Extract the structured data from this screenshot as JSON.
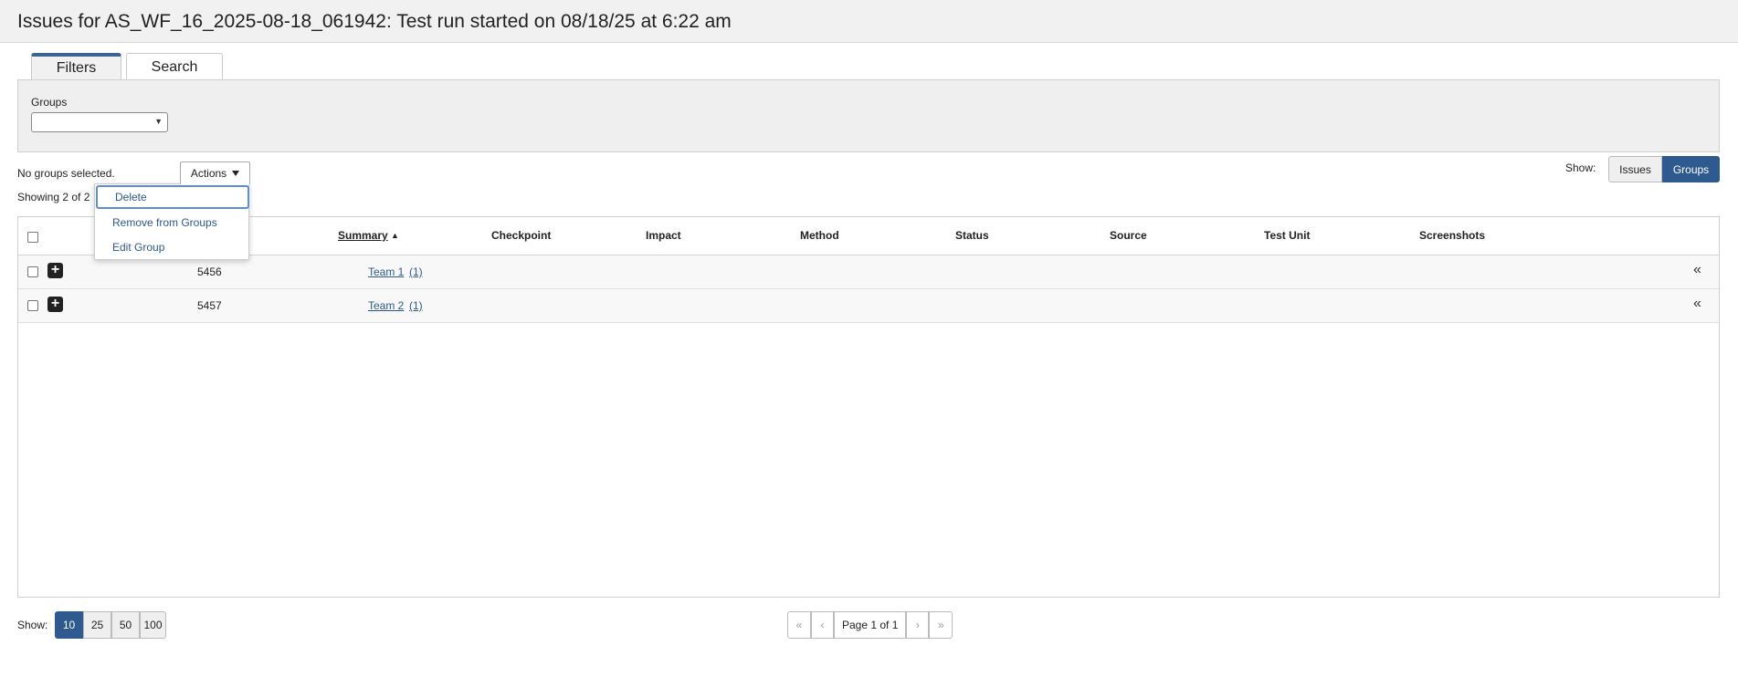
{
  "page": {
    "title": "Issues for AS_WF_16_2025-08-18_061942: Test run started on 08/18/25 at 6:22 am"
  },
  "tabs": [
    {
      "label": "Filters",
      "active": true
    },
    {
      "label": "Search",
      "active": false
    }
  ],
  "filters": {
    "groups_label": "Groups",
    "groups_value": ""
  },
  "status": {
    "selection_text": "No groups selected.",
    "showing_text": "Showing 2 of 2"
  },
  "actions": {
    "label": "Actions",
    "menu": [
      {
        "label": "Delete"
      },
      {
        "label": "Remove from Groups"
      },
      {
        "label": "Edit Group"
      }
    ]
  },
  "show_toggle": {
    "label": "Show:",
    "options": [
      {
        "label": "Issues",
        "selected": false
      },
      {
        "label": "Groups",
        "selected": true
      }
    ]
  },
  "table": {
    "columns": [
      "Summary",
      "Checkpoint",
      "Impact",
      "Method",
      "Status",
      "Source",
      "Test Unit",
      "Screenshots"
    ],
    "rows": [
      {
        "id": "5456",
        "summary": "Team 1",
        "count": "(1)"
      },
      {
        "id": "5457",
        "summary": "Team 2",
        "count": "(1)"
      }
    ]
  },
  "pagination": {
    "show_label": "Show:",
    "sizes": [
      "10",
      "25",
      "50",
      "100"
    ],
    "selected_size": "10",
    "page_label": "Page 1 of 1",
    "icons": {
      "first": "«",
      "prev": "‹",
      "next": "›",
      "last": "»"
    }
  },
  "icons": {
    "plus": "+",
    "collapse": "«",
    "sort_asc": "▲"
  },
  "colors": {
    "accent": "#2f5a8f",
    "link": "#2b5a8a",
    "panel": "#efefef"
  }
}
